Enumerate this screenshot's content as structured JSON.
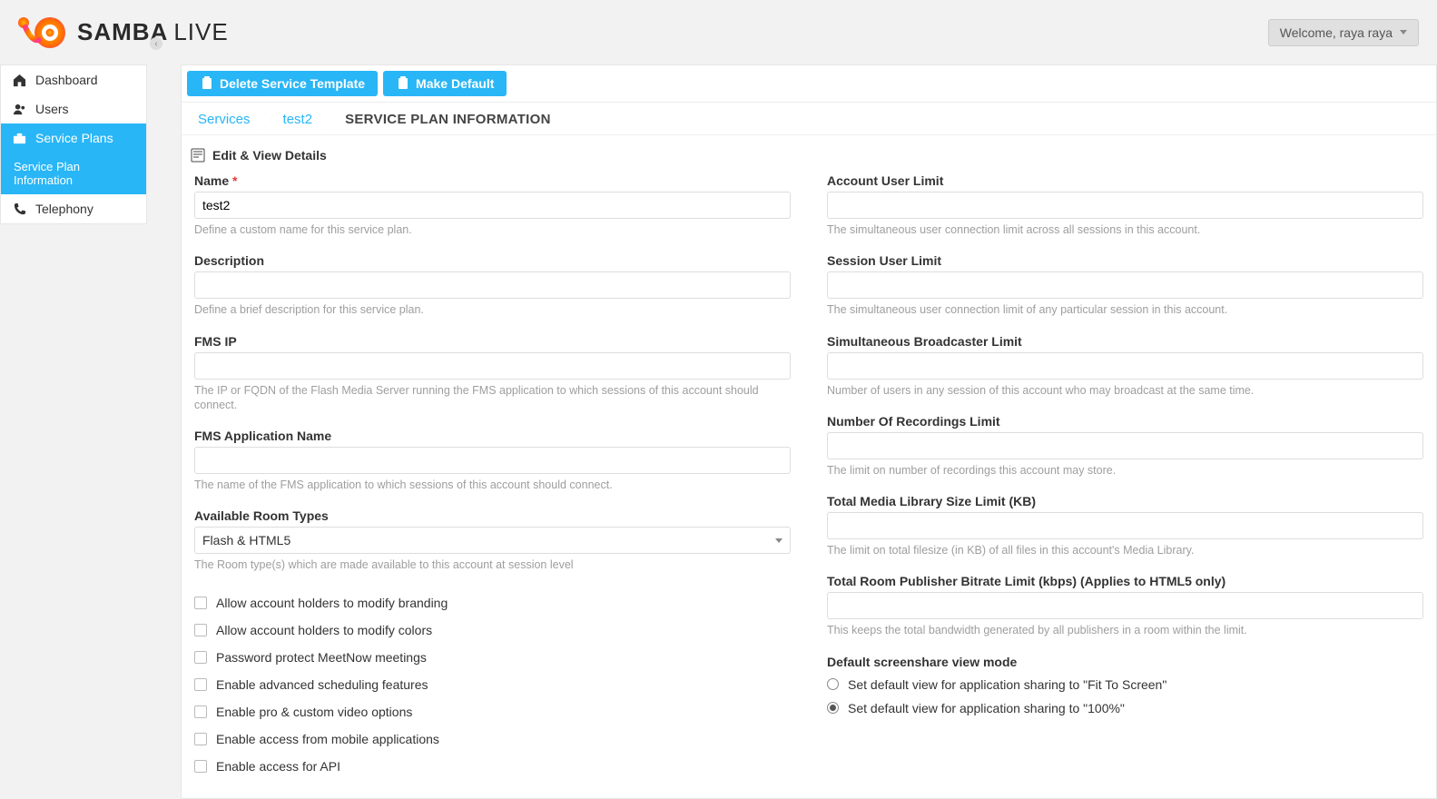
{
  "header": {
    "logo_bold": "SAMBA",
    "logo_thin": "LIVE",
    "welcome": "Welcome, raya raya"
  },
  "sidebar": {
    "items": [
      {
        "label": "Dashboard"
      },
      {
        "label": "Users"
      },
      {
        "label": "Service Plans"
      },
      {
        "label": "Service Plan Information"
      },
      {
        "label": "Telephony"
      }
    ]
  },
  "toolbar": {
    "delete": "Delete Service Template",
    "make_default": "Make Default"
  },
  "breadcrumb": {
    "a": "Services",
    "b": "test2",
    "c": "SERVICE PLAN INFORMATION"
  },
  "section_title": "Edit & View Details",
  "left": {
    "name_label": "Name",
    "name_value": "test2",
    "name_help": "Define a custom name for this service plan.",
    "desc_label": "Description",
    "desc_help": "Define a brief description for this service plan.",
    "fmsip_label": "FMS IP",
    "fmsip_help": "The IP or FQDN of the Flash Media Server running the FMS application to which sessions of this account should connect.",
    "fmsapp_label": "FMS Application Name",
    "fmsapp_help": "The name of the FMS application to which sessions of this account should connect.",
    "roomtypes_label": "Available Room Types",
    "roomtypes_value": "Flash & HTML5",
    "roomtypes_help": "The Room type(s) which are made available to this account at session level",
    "checks": [
      "Allow account holders to modify branding",
      "Allow account holders to modify colors",
      "Password protect MeetNow meetings",
      "Enable advanced scheduling features",
      "Enable pro & custom video options",
      "Enable access from mobile applications",
      "Enable access for API"
    ]
  },
  "right": {
    "aul_label": "Account User Limit",
    "aul_help": "The simultaneous user connection limit across all sessions in this account.",
    "sul_label": "Session User Limit",
    "sul_help": "The simultaneous user connection limit of any particular session in this account.",
    "sbl_label": "Simultaneous Broadcaster Limit",
    "sbl_help": "Number of users in any session of this account who may broadcast at the same time.",
    "nor_label": "Number Of Recordings Limit",
    "nor_help": "The limit on number of recordings this account may store.",
    "tml_label": "Total Media Library Size Limit (KB)",
    "tml_help": "The limit on total filesize (in KB) of all files in this account's Media Library.",
    "trp_label": "Total Room Publisher Bitrate Limit (kbps) (Applies to HTML5 only)",
    "trp_help": "This keeps the total bandwidth generated by all publishers in a room within the limit.",
    "ss_label": "Default screenshare view mode",
    "ss_opt1": "Set default view for application sharing to \"Fit To Screen\"",
    "ss_opt2": "Set default view for application sharing to \"100%\""
  }
}
